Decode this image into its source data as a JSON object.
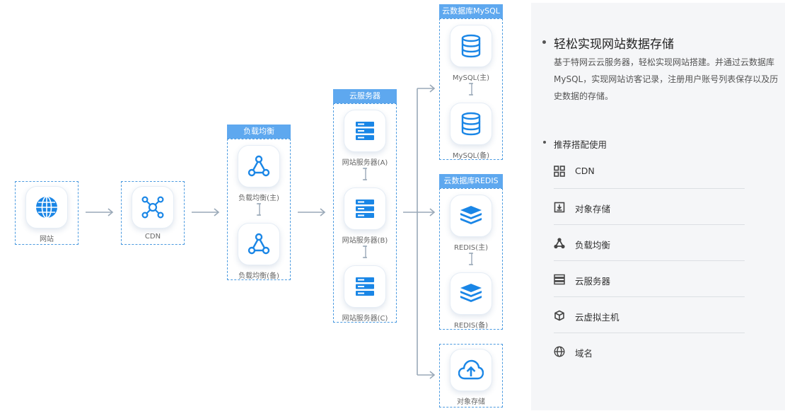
{
  "colors": {
    "accent": "#1a86e6",
    "header": "#5ea8ef",
    "border": "#4a9ae0",
    "arrow": "#9aa9b8",
    "panel": "#f5f6f8"
  },
  "diagram": {
    "website": {
      "label": "网站",
      "icon": "globe-icon"
    },
    "cdn": {
      "label": "CDN",
      "icon": "cdn-network-icon"
    },
    "lb": {
      "header": "负载均衡",
      "main": "负载均衡(主)",
      "backup": "负载均衡(备)",
      "icon": "load-balancer-icon"
    },
    "servers": {
      "header": "云服务器",
      "a": "网站服务器(A)",
      "b": "网站服务器(B)",
      "c": "网站服务器(C)",
      "icon": "server-icon"
    },
    "mysql": {
      "header": "云数据库MySQL",
      "main": "MySQL(主)",
      "backup": "MySQL(备)",
      "icon": "database-icon"
    },
    "redis": {
      "header": "云数据库REDIS",
      "main": "REDIS(主)",
      "backup": "REDIS(备)",
      "icon": "redis-stack-icon"
    },
    "storage": {
      "label": "对象存储",
      "icon": "cloud-upload-icon"
    }
  },
  "panel": {
    "title": "轻松实现网站数据存储",
    "description_lines": [
      "基于特网云云服务器，轻松实现网站搭建。并通过云数据库",
      "MySQL，实现网站访客记录，注册用户账号列表保存以及历",
      "史数据的存储。"
    ],
    "subtitle": "推荐搭配使用",
    "products": [
      {
        "label": "CDN",
        "icon": "grid-icon"
      },
      {
        "label": "对象存储",
        "icon": "storage-box-icon"
      },
      {
        "label": "负载均衡",
        "icon": "load-balancer-icon"
      },
      {
        "label": "云服务器",
        "icon": "server-icon"
      },
      {
        "label": "云虚拟主机",
        "icon": "cube-icon"
      },
      {
        "label": "域名",
        "icon": "globe-icon"
      }
    ]
  }
}
